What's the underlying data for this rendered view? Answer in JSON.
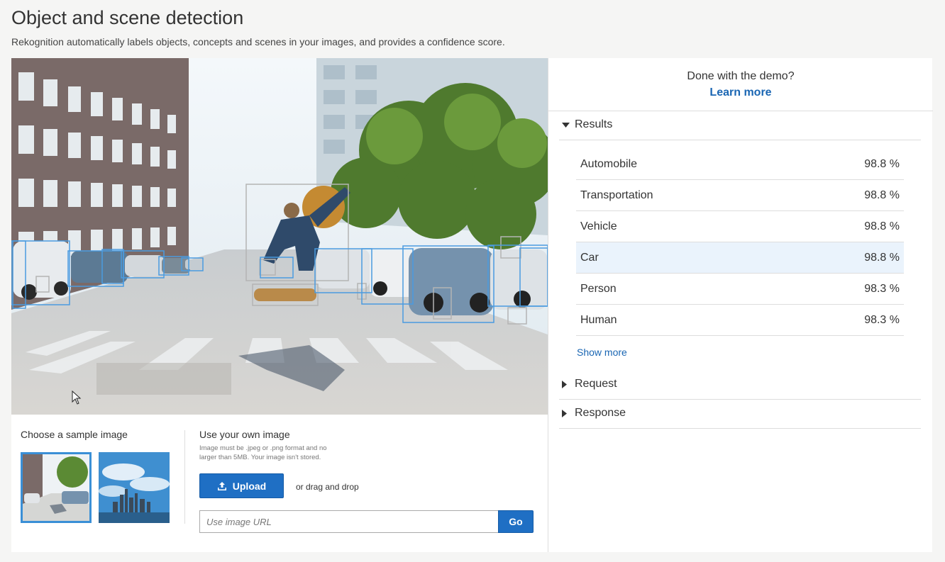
{
  "header": {
    "title": "Object and scene detection",
    "subtitle": "Rekognition automatically labels objects, concepts and scenes in your images, and provides a confidence score."
  },
  "samples": {
    "title": "Choose a sample image",
    "thumbnails": [
      {
        "name": "street-skateboarder",
        "selected": true
      },
      {
        "name": "city-skyline",
        "selected": false
      }
    ]
  },
  "own_image": {
    "title": "Use your own image",
    "note": "Image must be .jpeg or .png format and no larger than 5MB. Your image isn't stored.",
    "upload_label": "Upload",
    "drag_text": "or drag and drop",
    "url_placeholder": "Use image URL",
    "go_label": "Go"
  },
  "demo": {
    "done_text": "Done with the demo?",
    "learn_more": "Learn more"
  },
  "results_section": {
    "label": "Results",
    "expanded": true,
    "rows": [
      {
        "label": "Automobile",
        "confidence": "98.8 %"
      },
      {
        "label": "Transportation",
        "confidence": "98.8 %"
      },
      {
        "label": "Vehicle",
        "confidence": "98.8 %"
      },
      {
        "label": "Car",
        "confidence": "98.8 %",
        "highlighted": true
      },
      {
        "label": "Person",
        "confidence": "98.3 %"
      },
      {
        "label": "Human",
        "confidence": "98.3 %"
      }
    ],
    "show_more": "Show more"
  },
  "request_section": {
    "label": "Request",
    "expanded": false
  },
  "response_section": {
    "label": "Response",
    "expanded": false
  },
  "colors": {
    "accent": "#1f6fc4",
    "link": "#1a66b3",
    "box_blue": "#4a9be0",
    "box_gray": "#b4b4b4",
    "highlight_row": "#eaf3fc"
  }
}
